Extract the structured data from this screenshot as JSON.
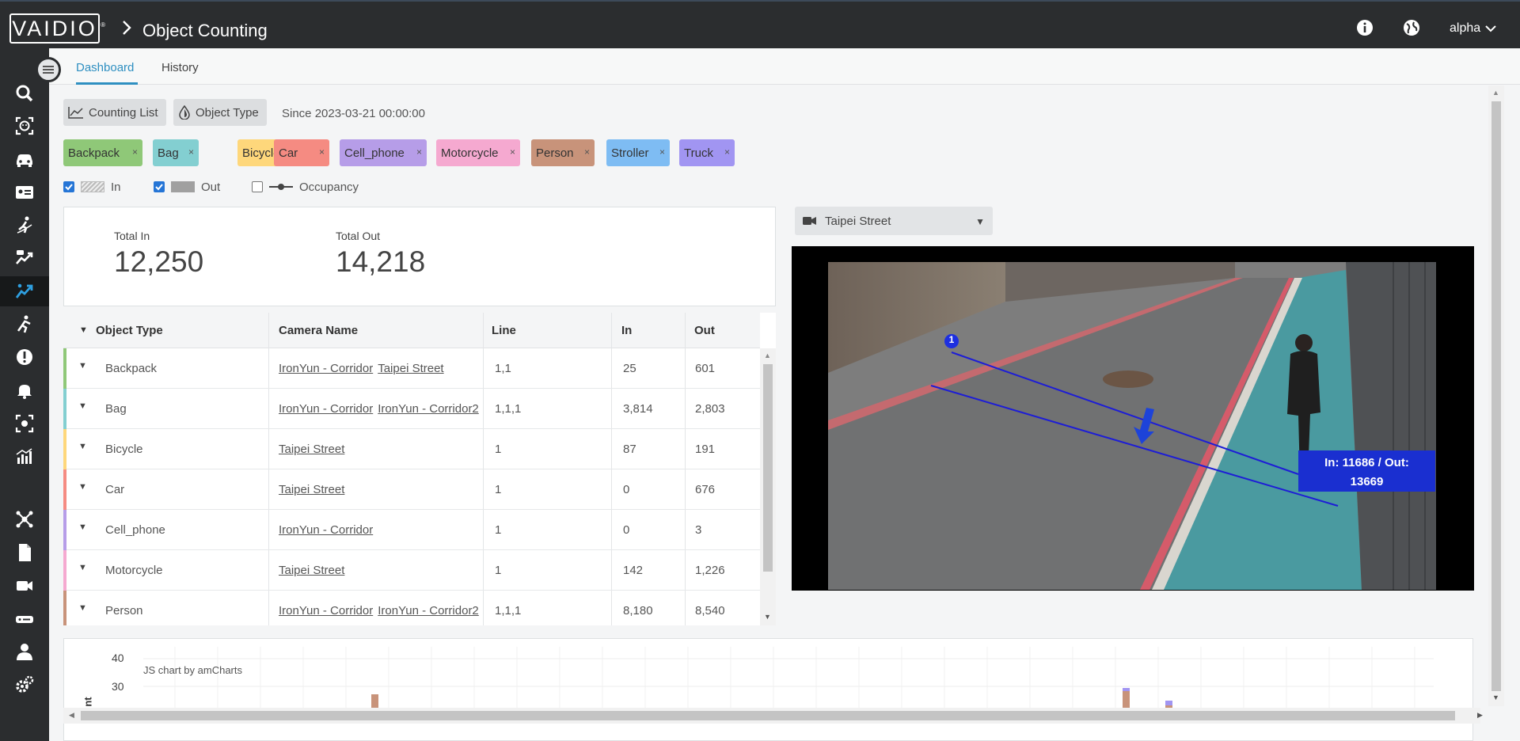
{
  "app": {
    "logo": "VAIDIO",
    "logo_mark": "®",
    "title": "Object Counting",
    "user": "alpha"
  },
  "tabs": [
    {
      "label": "Dashboard",
      "active": true
    },
    {
      "label": "History",
      "active": false
    }
  ],
  "toolbar": {
    "counting_list": "Counting List",
    "object_type": "Object Type",
    "since": "Since 2023-03-21 00:00:00"
  },
  "filters": [
    {
      "label": "Backpack",
      "color": "#8fc878"
    },
    {
      "label": "Bag",
      "color": "#83cfd1"
    },
    {
      "label": "Bicycle",
      "color": "#fed77b"
    },
    {
      "label": "Car",
      "color": "#f58b82"
    },
    {
      "label": "Cell_phone",
      "color": "#b69de8"
    },
    {
      "label": "Motorcycle",
      "color": "#f5a9d0"
    },
    {
      "label": "Person",
      "color": "#c8937a"
    },
    {
      "label": "Stroller",
      "color": "#7ebcf3"
    },
    {
      "label": "Truck",
      "color": "#a195f2"
    }
  ],
  "legend": {
    "in": "In",
    "out": "Out",
    "occupancy": "Occupancy"
  },
  "totals": {
    "in_label": "Total In",
    "in_value": "12,250",
    "out_label": "Total Out",
    "out_value": "14,218"
  },
  "table": {
    "headers": [
      "Object Type",
      "Camera Name",
      "Line",
      "In",
      "Out"
    ],
    "rows": [
      {
        "type": "Backpack",
        "cameras": [
          "IronYun - Corridor",
          "Taipei Street"
        ],
        "line": "1,1",
        "in": "25",
        "out": "601",
        "color": "#8fc878"
      },
      {
        "type": "Bag",
        "cameras": [
          "IronYun - Corridor",
          "IronYun - Corridor2"
        ],
        "line": "1,1,1",
        "in": "3,814",
        "out": "2,803",
        "color": "#83cfd1"
      },
      {
        "type": "Bicycle",
        "cameras": [
          "Taipei Street"
        ],
        "line": "1",
        "in": "87",
        "out": "191",
        "color": "#fed77b"
      },
      {
        "type": "Car",
        "cameras": [
          "Taipei Street"
        ],
        "line": "1",
        "in": "0",
        "out": "676",
        "color": "#f58b82"
      },
      {
        "type": "Cell_phone",
        "cameras": [
          "IronYun - Corridor"
        ],
        "line": "1",
        "in": "0",
        "out": "3",
        "color": "#b69de8"
      },
      {
        "type": "Motorcycle",
        "cameras": [
          "Taipei Street"
        ],
        "line": "1",
        "in": "142",
        "out": "1,226",
        "color": "#f5a9d0"
      },
      {
        "type": "Person",
        "cameras": [
          "IronYun - Corridor",
          "IronYun - Corridor2"
        ],
        "line": "1,1,1",
        "in": "8,180",
        "out": "8,540",
        "color": "#c8937a"
      }
    ]
  },
  "camera": {
    "selected": "Taipei Street",
    "line_marker": "1",
    "overlay_line1": "In: 11686 / Out:",
    "overlay_line2": "13669"
  },
  "chart": {
    "watermark": "JS chart by amCharts",
    "y_ticks": [
      "40",
      "30"
    ],
    "y_axis_partial": "nt"
  }
}
